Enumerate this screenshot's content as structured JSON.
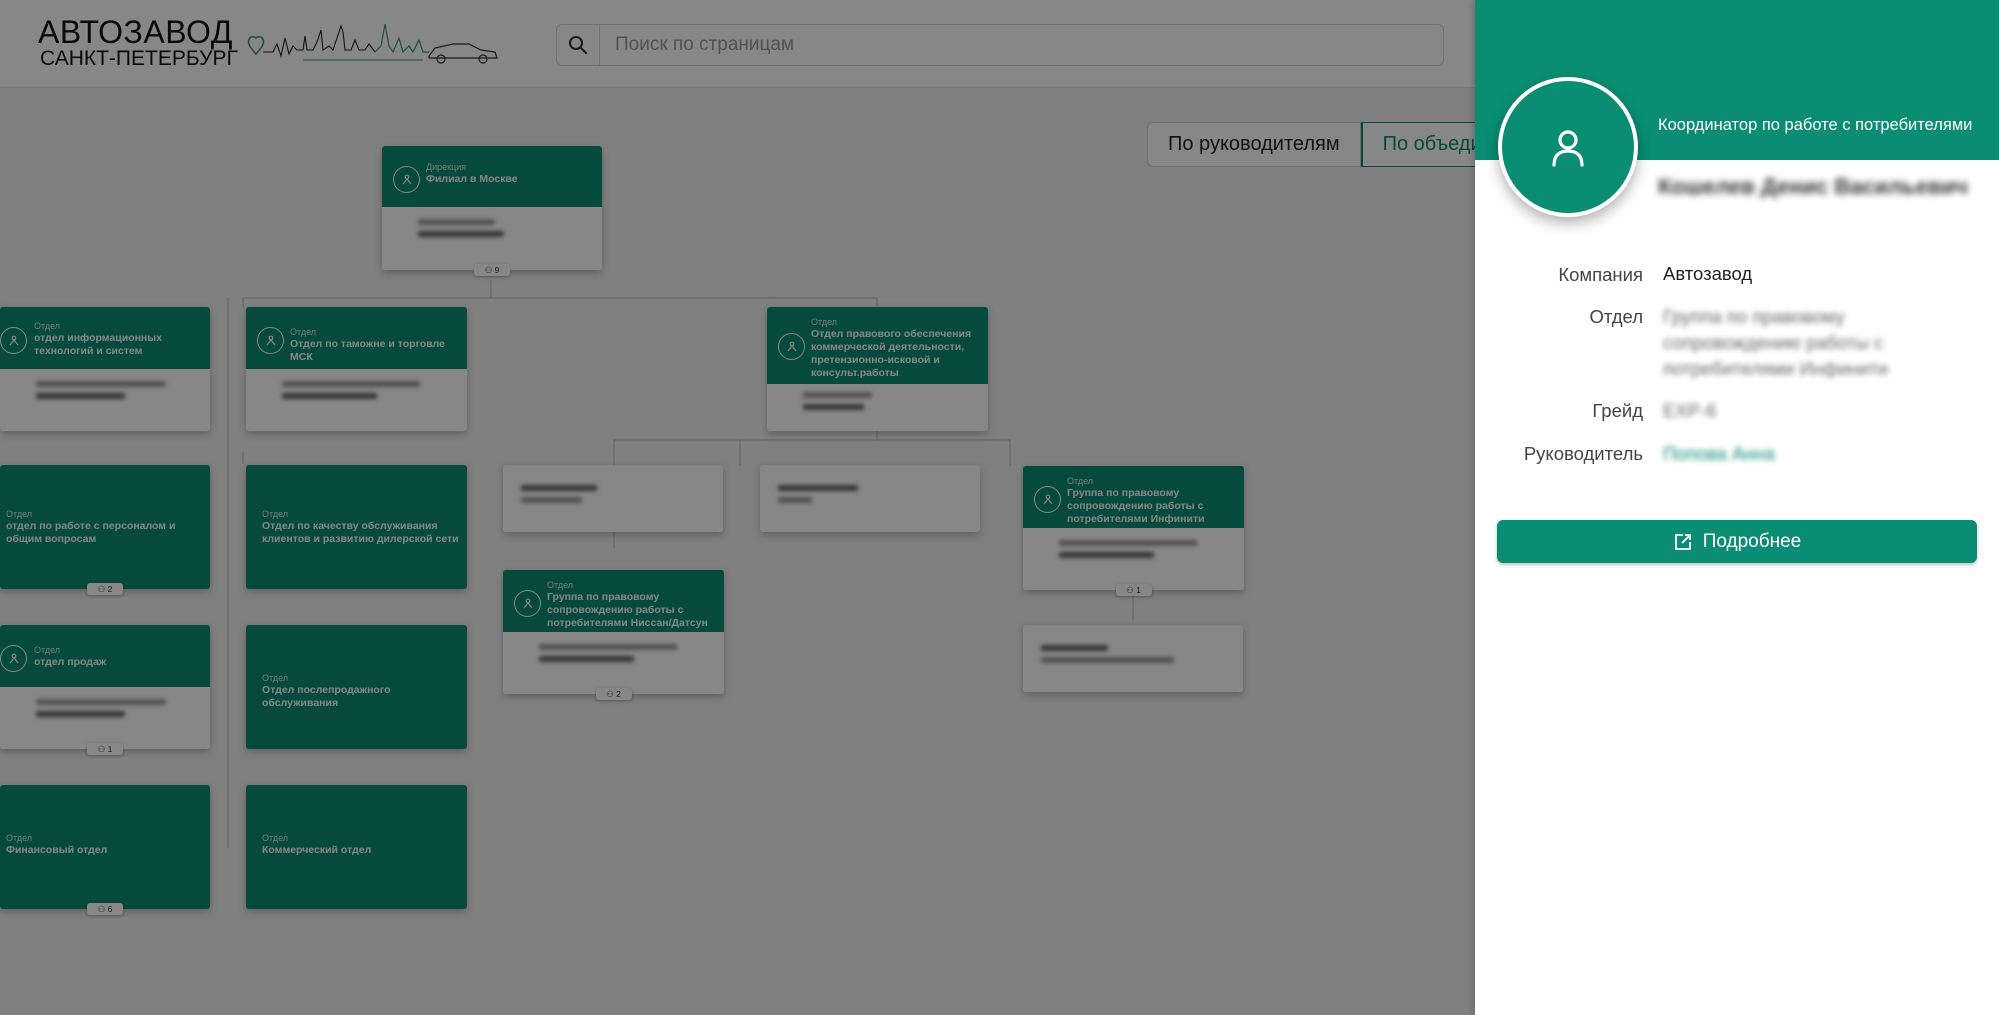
{
  "header": {
    "logo_line1": "АВТОЗАВОД",
    "logo_line2": "САНКТ-ПЕТЕРБУРГ",
    "search_placeholder": "Поиск по страницам"
  },
  "view_toggle": {
    "by_managers": "По руководителям",
    "by_units": "По объеди"
  },
  "org_chart": {
    "root": {
      "type": "Дирекция",
      "title": "Филиал в Москве",
      "count": "9"
    },
    "departments": [
      {
        "type": "Отдел",
        "title": "отдел информационных технологий и систем"
      },
      {
        "type": "Отдел",
        "title": "Отдел по таможне и торговле МСК"
      },
      {
        "type": "Отдел",
        "title": "Отдел правового обеспечения коммерческой деятельности, претензионно-исковой и консульт.работы"
      },
      {
        "type": "Отдел",
        "title": "отдел по работе с персоналом и общим вопросам",
        "count": "2"
      },
      {
        "type": "Отдел",
        "title": "Отдел по качеству обслуживания клиентов и развитию дилерской сети"
      },
      {
        "type": "Отдел",
        "title": "Группа по правовому сопровождению работы с потребителями Инфинити",
        "count": "1"
      },
      {
        "type": "Отдел",
        "title": "Группа по правовому сопровождению работы с потребителями Ниссан/Датсун",
        "count": "2"
      },
      {
        "type": "Отдел",
        "title": "отдел продаж",
        "count": "1"
      },
      {
        "type": "Отдел",
        "title": "Отдел послепродажного обслуживания"
      },
      {
        "type": "Отдел",
        "title": "Финансовый отдел",
        "count": "6"
      },
      {
        "type": "Отдел",
        "title": "Коммерческий отдел"
      }
    ]
  },
  "panel": {
    "position": "Координатор по работе с потребителями",
    "name": "Кошелев Денис Васильевич",
    "fields": {
      "company_label": "Компания",
      "company_value": "Автозавод",
      "department_label": "Отдел",
      "department_value": "Группа по правовому сопровождению работы с потребителями Инфинити",
      "grade_label": "Грейд",
      "grade_value": "EXP-6",
      "manager_label": "Руководитель",
      "manager_value": "Попова Анна"
    },
    "details_button": "Подробнее"
  },
  "colors": {
    "brand_green": "#0a8d72",
    "overlay": "rgba(0,0,0,0.47)"
  },
  "icons": [
    "search-icon",
    "org-unit-icon",
    "person-icon",
    "user-avatar-icon",
    "external-link-icon",
    "heart-icon",
    "skyline-icon",
    "car-icon"
  ]
}
